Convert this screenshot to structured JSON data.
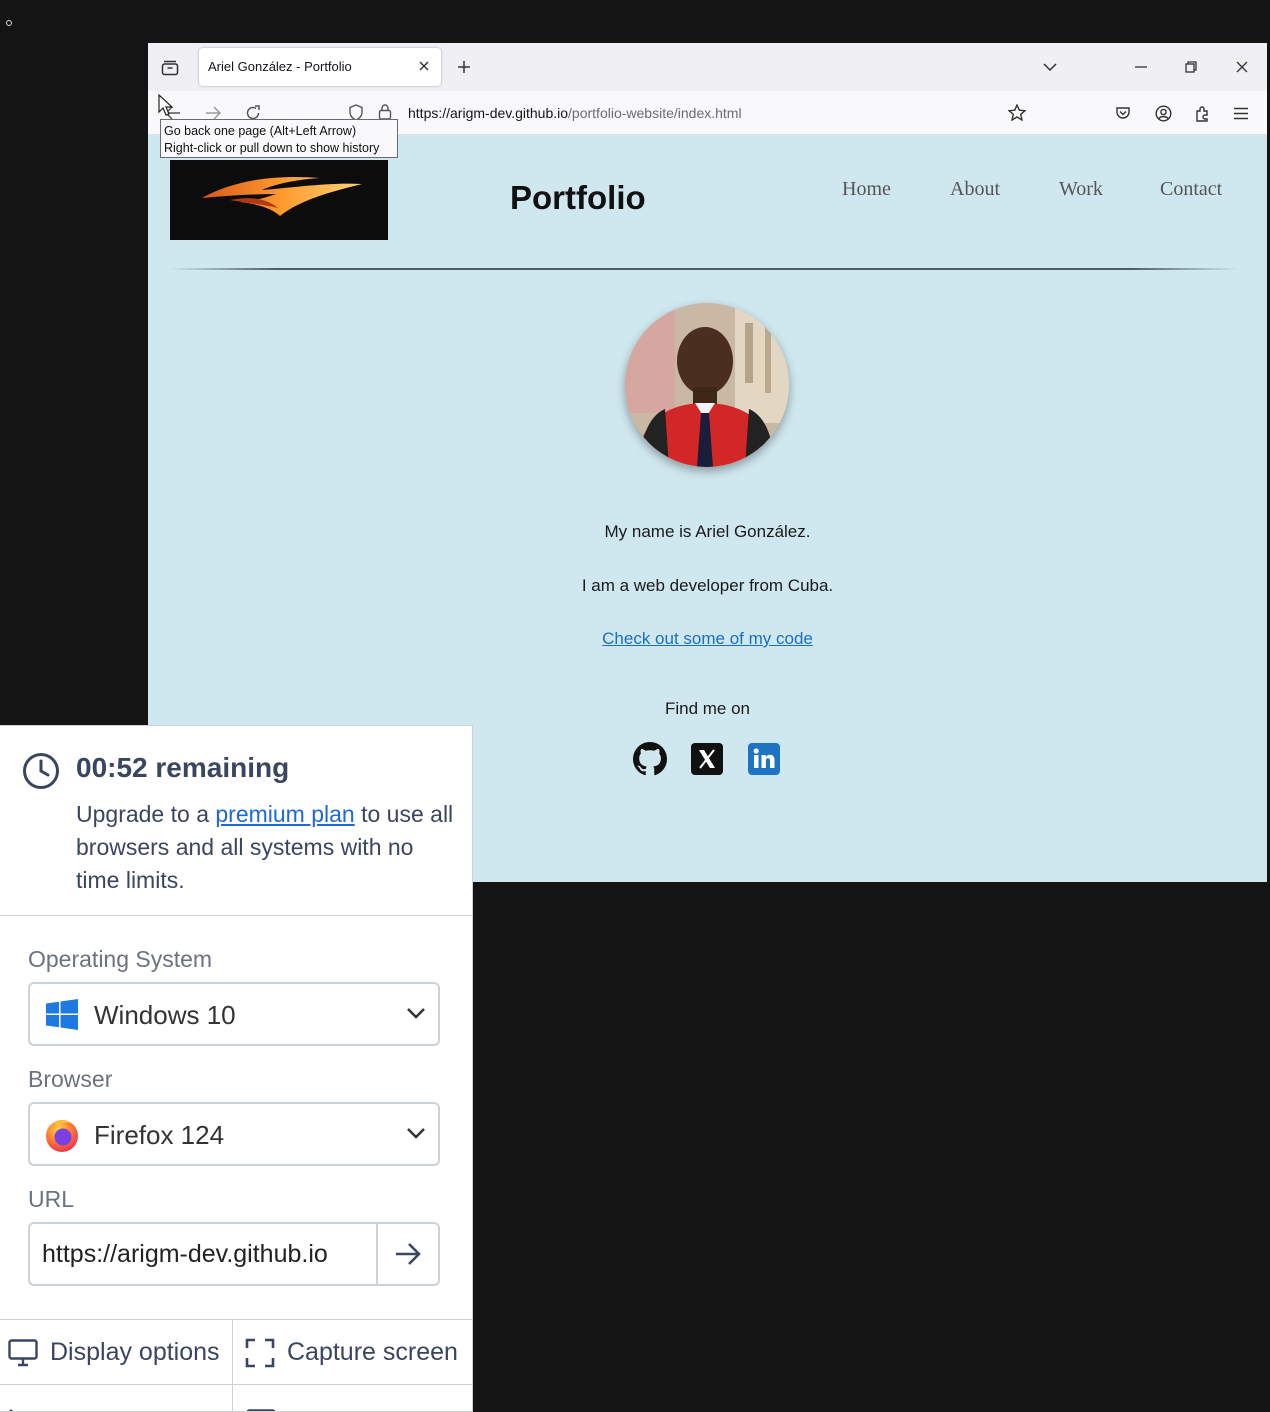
{
  "browser": {
    "tab_title": "Ariel González - Portfolio",
    "url_host": "https://arigm-dev.github.io",
    "url_path": "/portfolio-website/index.html",
    "tooltip_line1": "Go back one page (Alt+Left Arrow)",
    "tooltip_line2": "Right-click or pull down to show history"
  },
  "site": {
    "title": "Portfolio",
    "nav": [
      "Home",
      "About",
      "Work",
      "Contact"
    ],
    "intro_name": "My name is Ariel González.",
    "intro_role": "I am a web developer from Cuba.",
    "code_link": "Check out some of my code",
    "find_me": "Find me on",
    "social": [
      "github-icon",
      "x-icon",
      "linkedin-icon"
    ]
  },
  "panel": {
    "timer": "00:52 remaining",
    "upgrade_pre": "Upgrade to a ",
    "upgrade_link": "premium plan",
    "upgrade_post": " to use all browsers and all systems with no time limits.",
    "os_label": "Operating System",
    "os_value": "Windows 10",
    "browser_label": "Browser",
    "browser_value": "Firefox 124",
    "url_label": "URL",
    "url_value": "https://arigm-dev.github.io",
    "display_options": "Display options",
    "capture_screen": "Capture screen"
  },
  "colors": {
    "page_bg": "#cfe8ef",
    "link": "#1b6fc0",
    "panel_text": "#3a4560"
  }
}
